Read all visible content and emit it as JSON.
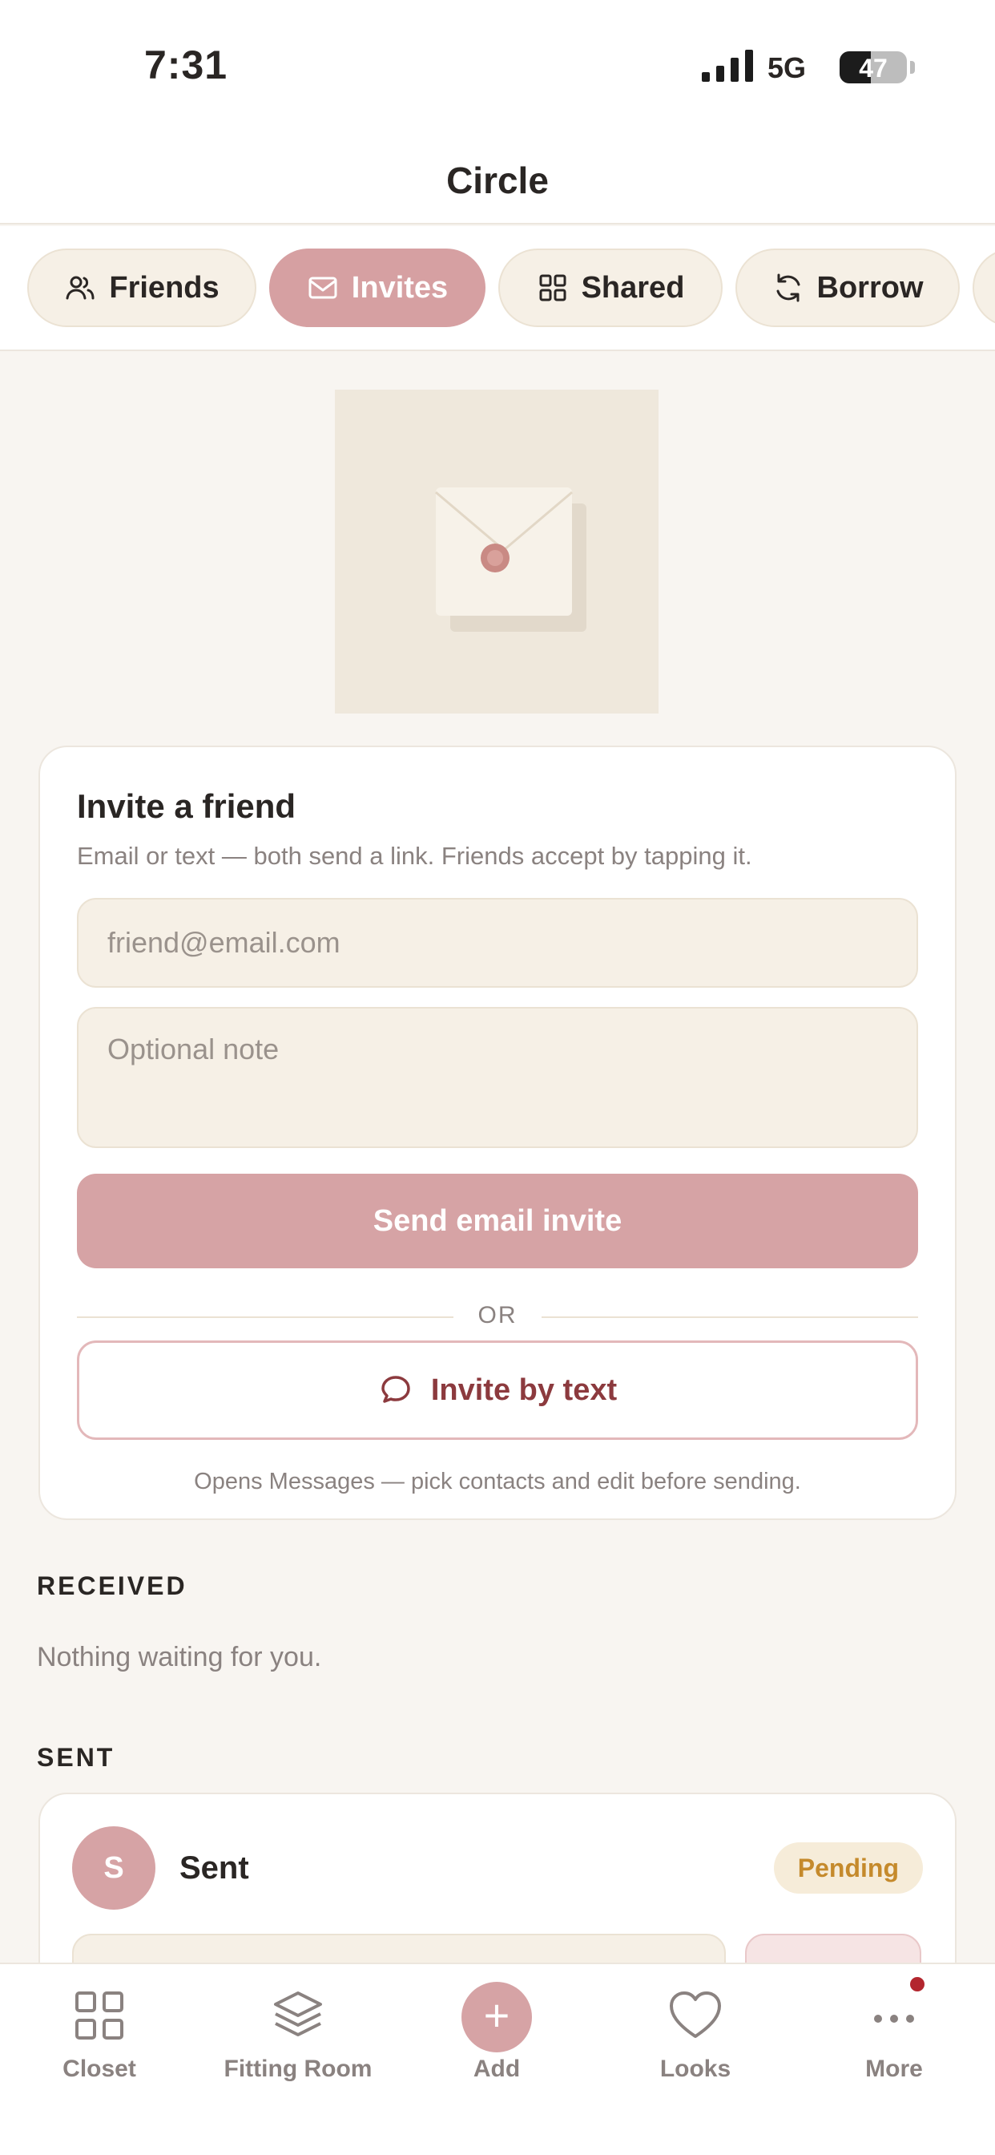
{
  "status": {
    "time": "7:31",
    "network": "5G",
    "battery": "47",
    "battery_level": 0.47
  },
  "header": {
    "title": "Circle"
  },
  "tabs": [
    {
      "label": "Friends",
      "icon": "people-icon",
      "active": false
    },
    {
      "label": "Invites",
      "icon": "mail-icon",
      "active": true
    },
    {
      "label": "Shared",
      "icon": "grid-icon",
      "active": false
    },
    {
      "label": "Borrow",
      "icon": "refresh-icon",
      "active": false
    }
  ],
  "hero": {
    "image": "envelope-illustration"
  },
  "invite": {
    "title": "Invite a friend",
    "subtitle": "Email or text — both send a link. Friends accept by tapping it.",
    "email_placeholder": "friend@email.com",
    "note_placeholder": "Optional note",
    "send_label": "Send email invite",
    "or_label": "OR",
    "text_label": "Invite by text",
    "hint": "Opens Messages — pick contacts and edit before sending."
  },
  "received": {
    "label": "RECEIVED",
    "empty": "Nothing waiting for you."
  },
  "sent": {
    "label": "SENT",
    "items": [
      {
        "initial": "S",
        "name": "Sent",
        "status": "Pending"
      }
    ]
  },
  "nav": [
    {
      "label": "Closet",
      "icon": "grid-icon"
    },
    {
      "label": "Fitting Room",
      "icon": "layers-icon"
    },
    {
      "label": "Add",
      "icon": "plus-icon"
    },
    {
      "label": "Looks",
      "icon": "heart-icon"
    },
    {
      "label": "More",
      "icon": "ellipsis-icon",
      "has_notification": true
    }
  ],
  "colors": {
    "accent": "#d6a3a5",
    "background": "#f8f5f1",
    "pending": "#c58a2c",
    "notification": "#b3262e"
  }
}
